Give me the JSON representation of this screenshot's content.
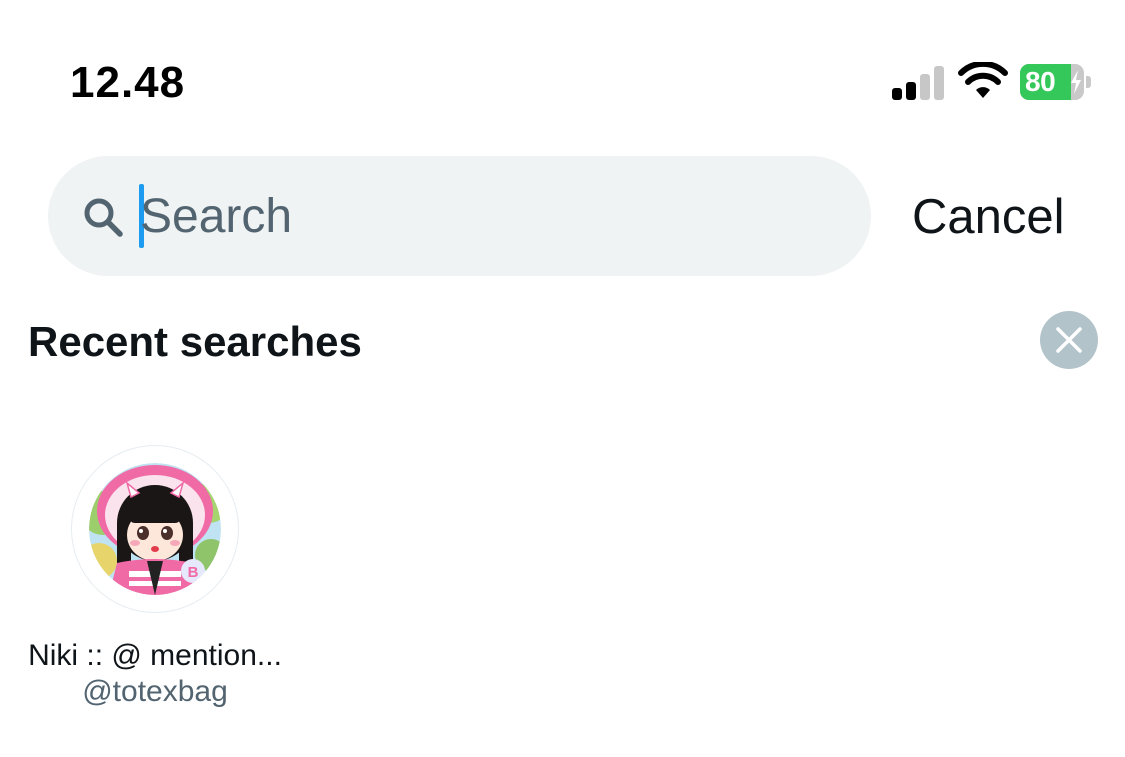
{
  "status_bar": {
    "time": "12.48",
    "battery_level": "80",
    "battery_fraction": 0.8,
    "signal_bars_active": 2,
    "signal_bars_total": 4,
    "icons": [
      "signal-icon",
      "wifi-icon",
      "battery-charging-icon"
    ]
  },
  "search": {
    "placeholder": "Search",
    "value": "",
    "icon": "search-icon"
  },
  "cancel_label": "Cancel",
  "recent": {
    "title": "Recent searches",
    "clear_icon": "close-icon",
    "accounts": [
      {
        "name": "Niki :: @ mention...",
        "handle": "@totexbag"
      }
    ]
  },
  "colors": {
    "accent": "#1d9bf0",
    "search_bg": "#eff3f4",
    "secondary_text": "#536471",
    "clear_button_bg": "#b3c3ca",
    "battery_green": "#34c759"
  }
}
